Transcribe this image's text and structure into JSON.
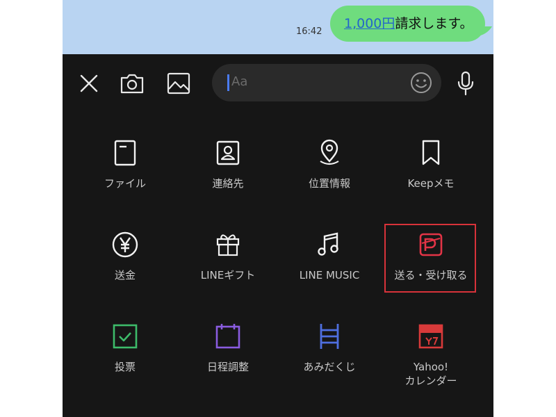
{
  "chat": {
    "time": "16:42",
    "message_amount": "1,000円",
    "message_rest": "請求します。"
  },
  "toolbar": {
    "placeholder": "Aa",
    "icons": [
      "close-icon",
      "camera-icon",
      "image-icon",
      "emoji-icon",
      "microphone-icon"
    ]
  },
  "menu": {
    "row1": [
      {
        "label": "ファイル",
        "icon": "file-icon"
      },
      {
        "label": "連絡先",
        "icon": "contact-icon"
      },
      {
        "label": "位置情報",
        "icon": "location-icon"
      },
      {
        "label": "Keepメモ",
        "icon": "bookmark-icon"
      }
    ],
    "row2": [
      {
        "label": "送金",
        "icon": "yen-icon"
      },
      {
        "label": "LINEギフト",
        "icon": "gift-icon"
      },
      {
        "label": "LINE MUSIC",
        "icon": "music-note-icon"
      },
      {
        "label": "送る・受け取る",
        "icon": "paypay-icon"
      }
    ],
    "row3": [
      {
        "label": "投票",
        "icon": "vote-icon"
      },
      {
        "label": "日程調整",
        "icon": "calendar-icon"
      },
      {
        "label": "あみだくじ",
        "icon": "ladder-icon"
      },
      {
        "label": "Yahoo!\nカレンダー",
        "icon": "yahoo-calendar-icon"
      }
    ]
  },
  "colors": {
    "panel": "#161616",
    "chat_bg": "#b9d4f2",
    "bubble": "#6fdc7e",
    "highlight": "#d8323a",
    "vote": "#3dbb6a",
    "schedule": "#8a5ce0",
    "amida": "#4f6fe0",
    "yahoo": "#d83a3a"
  }
}
